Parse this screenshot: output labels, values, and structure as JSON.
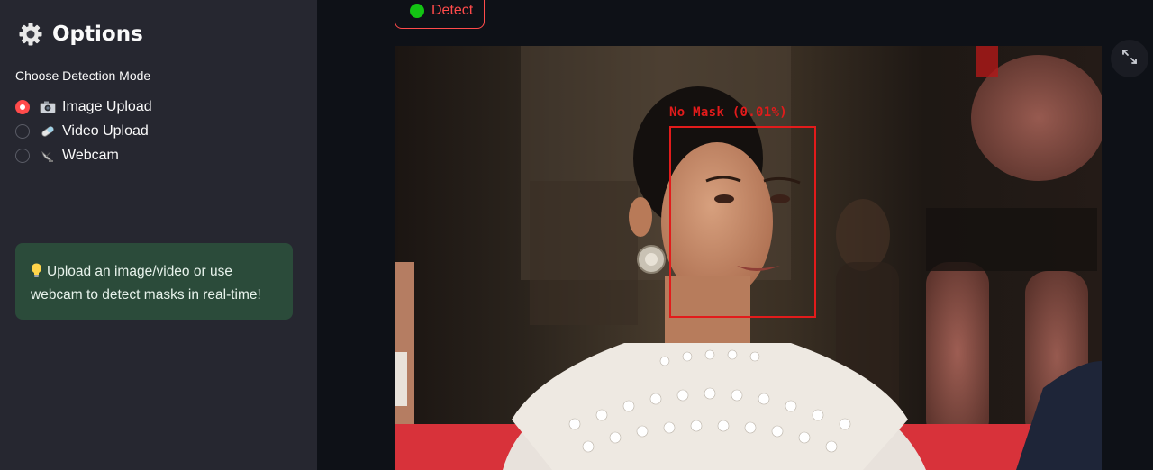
{
  "sidebar": {
    "title": "Options",
    "header_icon": "gear-icon",
    "mode_label": "Choose Detection Mode",
    "modes": [
      {
        "icon": "camera-icon",
        "label": "Image Upload",
        "checked": true
      },
      {
        "icon": "pill-icon",
        "label": "Video Upload",
        "checked": false
      },
      {
        "icon": "satellite-dish-icon",
        "label": "Webcam",
        "checked": false
      }
    ],
    "info_icon": "lightbulb-icon",
    "info_text": "Upload an image/video or use webcam to detect masks in real-time!"
  },
  "main": {
    "detect_button": {
      "label": "Detect",
      "status_color": "#13c413"
    },
    "fullscreen_icon": "expand-icon",
    "detection": {
      "label": "No Mask (0.01%)",
      "color": "#e21b1b"
    }
  },
  "colors": {
    "accent": "#ff4b4b",
    "sidebar_bg": "#262730",
    "app_bg": "#0e1117",
    "info_bg": "#2b4b3a"
  }
}
